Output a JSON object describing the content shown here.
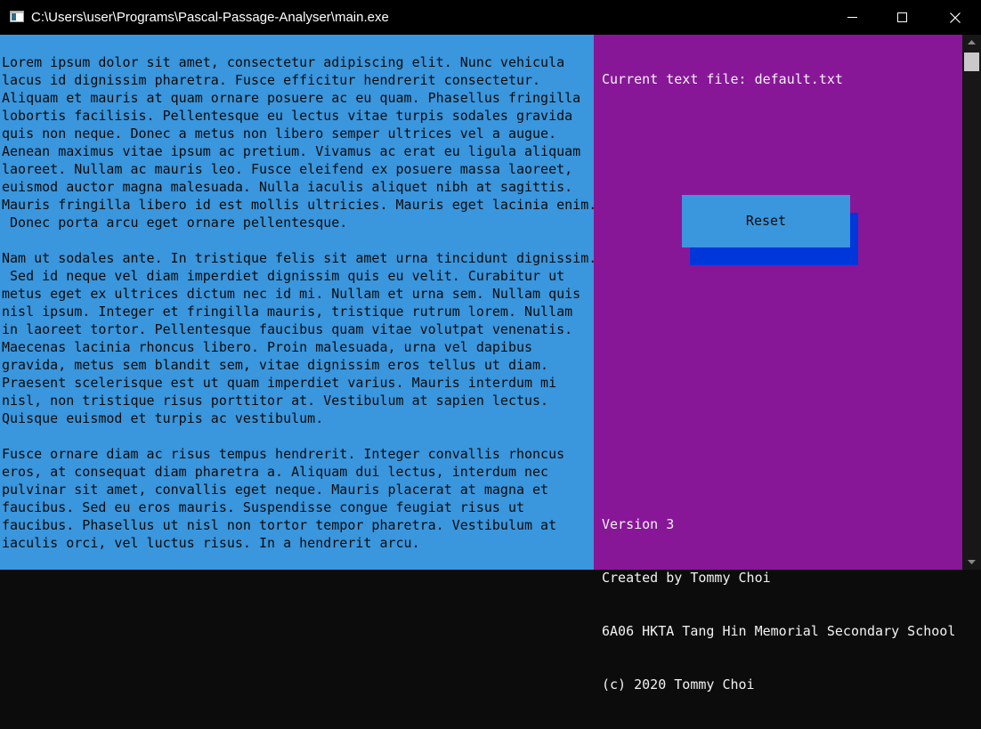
{
  "window": {
    "title": "C:\\Users\\user\\Programs\\Pascal-Passage-Analyser\\main.exe",
    "buttons": [
      "minimize",
      "maximize",
      "close"
    ]
  },
  "colors": {
    "text_pane_bg": "#3a96dd",
    "side_pane_bg": "#881798",
    "button_shadow": "#0037da",
    "title_bar": "#000000"
  },
  "passage": {
    "lines": [
      "Lorem ipsum dolor sit amet, consectetur adipiscing elit. Nunc vehicula",
      "lacus id dignissim pharetra. Fusce efficitur hendrerit consectetur.",
      "Aliquam et mauris at quam ornare posuere ac eu quam. Phasellus fringilla",
      "lobortis facilisis. Pellentesque eu lectus vitae turpis sodales gravida",
      "quis non neque. Donec a metus non libero semper ultrices vel a augue.",
      "Aenean maximus vitae ipsum ac pretium. Vivamus ac erat eu ligula aliquam",
      "laoreet. Nullam ac mauris leo. Fusce eleifend ex posuere massa laoreet,",
      "euismod auctor magna malesuada. Nulla iaculis aliquet nibh at sagittis.",
      "Mauris fringilla libero id est mollis ultricies. Mauris eget lacinia enim.",
      " Donec porta arcu eget ornare pellentesque.",
      "",
      "Nam ut sodales ante. In tristique felis sit amet urna tincidunt dignissim.",
      " Sed id neque vel diam imperdiet dignissim quis eu velit. Curabitur ut",
      "metus eget ex ultrices dictum nec id mi. Nullam et urna sem. Nullam quis",
      "nisl ipsum. Integer et fringilla mauris, tristique rutrum lorem. Nullam",
      "in laoreet tortor. Pellentesque faucibus quam vitae volutpat venenatis.",
      "Maecenas lacinia rhoncus libero. Proin malesuada, urna vel dapibus",
      "gravida, metus sem blandit sem, vitae dignissim eros tellus ut diam.",
      "Praesent scelerisque est ut quam imperdiet varius. Mauris interdum mi",
      "nisl, non tristique risus porttitor at. Vestibulum at sapien lectus.",
      "Quisque euismod et turpis ac vestibulum.",
      "",
      "Fusce ornare diam ac risus tempus hendrerit. Integer convallis rhoncus",
      "eros, at consequat diam pharetra a. Aliquam dui lectus, interdum nec",
      "pulvinar sit amet, convallis eget neque. Mauris placerat at magna et",
      "faucibus. Sed eu eros mauris. Suspendisse congue feugiat risus ut",
      "faucibus. Phasellus ut nisl non tortor tempor pharetra. Vestibulum at",
      "iaculis orci, vel luctus risus. In a hendrerit arcu."
    ]
  },
  "sidebar": {
    "current_file_label": "Current text file: default.txt",
    "reset_label": "Reset",
    "info": [
      "Version 3",
      "Created by Tommy Choi",
      "6A06 HKTA Tang Hin Memorial Secondary School",
      "(c) 2020 Tommy Choi"
    ]
  }
}
